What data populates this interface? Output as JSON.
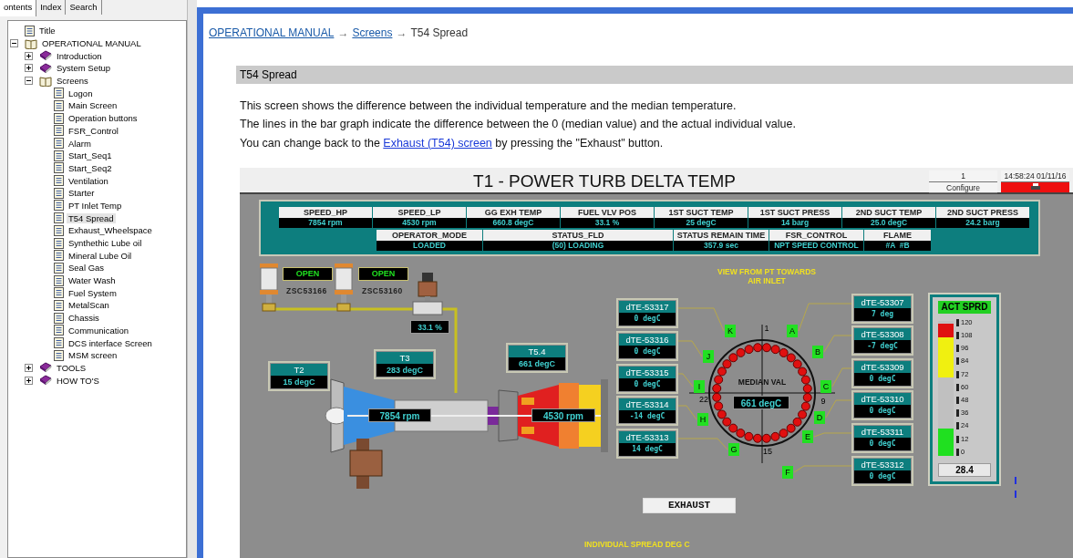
{
  "sidebar": {
    "tabs": [
      {
        "label": "ontents",
        "selected": true
      },
      {
        "label": "Index",
        "selected": false
      },
      {
        "label": "Search",
        "selected": false
      }
    ],
    "tree": [
      {
        "kind": "page",
        "label": "Title",
        "selected": false
      },
      {
        "kind": "book",
        "label": "OPERATIONAL MANUAL",
        "expanded": true,
        "selected": false,
        "children": [
          {
            "kind": "book",
            "label": "Introduction",
            "expanded": false,
            "selected": false
          },
          {
            "kind": "book",
            "label": "System Setup",
            "expanded": false,
            "selected": false
          },
          {
            "kind": "book",
            "label": "Screens",
            "expanded": true,
            "selected": false,
            "children": [
              {
                "kind": "page",
                "label": "Logon",
                "selected": false
              },
              {
                "kind": "page",
                "label": "Main Screen",
                "selected": false
              },
              {
                "kind": "page",
                "label": "Operation buttons",
                "selected": false
              },
              {
                "kind": "page",
                "label": "FSR_Control",
                "selected": false
              },
              {
                "kind": "page",
                "label": "Alarm",
                "selected": false
              },
              {
                "kind": "page",
                "label": "Start_Seq1",
                "selected": false
              },
              {
                "kind": "page",
                "label": "Start_Seq2",
                "selected": false
              },
              {
                "kind": "page",
                "label": "Ventilation",
                "selected": false
              },
              {
                "kind": "page",
                "label": "Starter",
                "selected": false
              },
              {
                "kind": "page",
                "label": "PT Inlet Temp",
                "selected": false
              },
              {
                "kind": "page",
                "label": "T54 Spread",
                "selected": true
              },
              {
                "kind": "page",
                "label": "Exhaust_Wheelspace",
                "selected": false
              },
              {
                "kind": "page",
                "label": "Synthethic Lube oil",
                "selected": false
              },
              {
                "kind": "page",
                "label": "Mineral Lube Oil",
                "selected": false
              },
              {
                "kind": "page",
                "label": "Seal Gas",
                "selected": false
              },
              {
                "kind": "page",
                "label": "Water Wash",
                "selected": false
              },
              {
                "kind": "page",
                "label": "Fuel System",
                "selected": false
              },
              {
                "kind": "page",
                "label": "MetalScan",
                "selected": false
              },
              {
                "kind": "page",
                "label": "Chassis",
                "selected": false
              },
              {
                "kind": "page",
                "label": "Communication",
                "selected": false
              },
              {
                "kind": "page",
                "label": "DCS interface Screen",
                "selected": false
              },
              {
                "kind": "page",
                "label": "MSM screen",
                "selected": false
              }
            ]
          },
          {
            "kind": "book",
            "label": "TOOLS",
            "expanded": false,
            "selected": false
          },
          {
            "kind": "book",
            "label": "HOW TO'S",
            "expanded": false,
            "selected": false
          }
        ]
      }
    ]
  },
  "breadcrumb": [
    {
      "label": "OPERATIONAL MANUAL",
      "kind": "link"
    },
    {
      "label": "Screens",
      "kind": "link",
      "separator": "→"
    },
    {
      "label": "T54 Spread",
      "kind": "current",
      "separator": "→"
    }
  ],
  "topic": {
    "heading": "T54 Spread",
    "paragraphs": [
      {
        "text": "This screen shows the difference between the individual temperature and the median temperature."
      },
      {
        "text": "The lines in the bar graph indicate the difference between the 0 (median value) and the actual individual value."
      },
      {
        "text": "You can change back to the ",
        "link": "Exhaust (T54) screen",
        "after": " by pressing the \"Exhaust\" button."
      }
    ]
  },
  "hmi": {
    "title": "T1 - POWER TURB DELTA TEMP",
    "counter": "1",
    "configure_button": "Configure",
    "clock": "14:58:24 01/11/16",
    "alarm_active": true,
    "readouts_top": [
      {
        "label": "SPEED_HP",
        "value": "7854 rpm"
      },
      {
        "label": "SPEED_LP",
        "value": "4530 rpm"
      },
      {
        "label": "GG EXH TEMP",
        "value": "660.8 degC"
      },
      {
        "label": "FUEL VLV POS",
        "value": "33.1 %"
      },
      {
        "label": "1ST SUCT TEMP",
        "value": "25 degC"
      },
      {
        "label": "1ST SUCT PRESS",
        "value": "14 barg"
      },
      {
        "label": "2ND SUCT TEMP",
        "value": "25.0 degC"
      },
      {
        "label": "2ND SUCT PRESS",
        "value": "24.2 barg"
      }
    ],
    "readouts_bottom": [
      {
        "label": "OPERATOR_MODE",
        "value": "LOADED"
      },
      {
        "label": "STATUS_FLD",
        "value": "(50) LOADING"
      },
      {
        "label": "STATUS REMAIN TIME",
        "value": "357.9 sec"
      },
      {
        "label": "FSR_CONTROL",
        "value": "NPT SPEED CONTROL"
      },
      {
        "label": "FLAME",
        "value": "#A  #B"
      }
    ],
    "valves": [
      {
        "tag": "ZSC53166",
        "status": "OPEN"
      },
      {
        "tag": "ZSC53160",
        "status": "OPEN"
      }
    ],
    "fuel_valve_reading": "33.1 %",
    "temps": [
      {
        "label": "T2",
        "value": "15 degC"
      },
      {
        "label": "T3",
        "value": "283 degC"
      },
      {
        "label": "T5.4",
        "value": "661 degC"
      }
    ],
    "hp_speed": "7854 rpm",
    "lp_speed": "4530 rpm",
    "view_caption": "VIEW FROM PT TOWARDS\nAIR INLET",
    "sensors_left": [
      {
        "tag": "dTE-53317",
        "value": "0 degC"
      },
      {
        "tag": "dTE-53316",
        "value": "0 degC"
      },
      {
        "tag": "dTE-53315",
        "value": "0 degC"
      },
      {
        "tag": "dTE-53314",
        "value": "-14 degC"
      },
      {
        "tag": "dTE-53313",
        "value": "14 degC"
      }
    ],
    "sensors_right": [
      {
        "tag": "dTE-53307",
        "value": "7 deg"
      },
      {
        "tag": "dTE-53308",
        "value": "-7 degC"
      },
      {
        "tag": "dTE-53309",
        "value": "0 degC"
      },
      {
        "tag": "dTE-53310",
        "value": "0 degC"
      },
      {
        "tag": "dTE-53311",
        "value": "0 degC"
      },
      {
        "tag": "dTE-53312",
        "value": "0 degC"
      }
    ],
    "ring_letters": [
      "A",
      "B",
      "C",
      "D",
      "E",
      "F",
      "G",
      "H",
      "I",
      "J",
      "K"
    ],
    "ring_numbers": [
      "1",
      "9",
      "15",
      "22"
    ],
    "median_label": "MEDIAN VAL",
    "median_value": "661 degC",
    "spread_meter": {
      "title": "ACT SPRD",
      "scale": [
        "120",
        "108",
        "96",
        "84",
        "72",
        "60",
        "48",
        "36",
        "24",
        "12",
        "0"
      ],
      "level": 0.2,
      "reading": "28.4"
    },
    "exhaust_button": "EXHAUST",
    "footer_caption": "INDIVIDUAL SPREAD DEG C"
  }
}
